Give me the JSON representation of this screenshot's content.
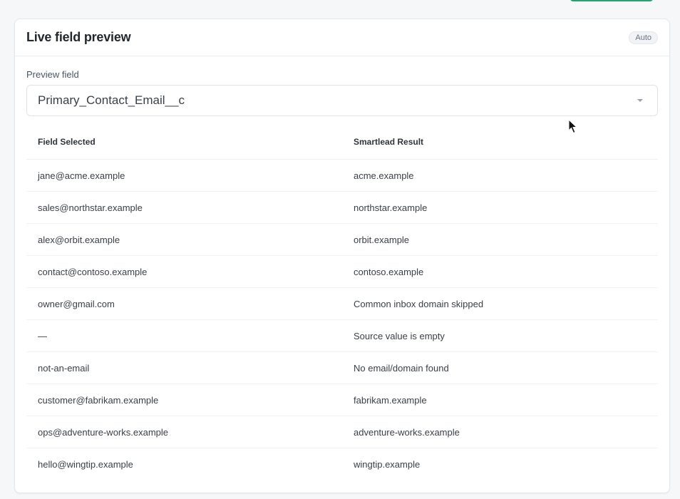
{
  "panel": {
    "title": "Live field preview",
    "badge": "Auto"
  },
  "preview_field": {
    "label": "Preview field",
    "value": "Primary_Contact_Email__c",
    "icon": "chevron-down-icon"
  },
  "table": {
    "columns": [
      "Field Selected",
      "Smartlead Result"
    ],
    "rows": [
      {
        "field": "jane@acme.example",
        "result": "acme.example",
        "muted": false
      },
      {
        "field": "sales@northstar.example",
        "result": "northstar.example",
        "muted": false
      },
      {
        "field": "alex@orbit.example",
        "result": "orbit.example",
        "muted": false
      },
      {
        "field": "contact@contoso.example",
        "result": "contoso.example",
        "muted": false
      },
      {
        "field": "owner@gmail.com",
        "result": "Common inbox domain skipped",
        "muted": true
      },
      {
        "field": "—",
        "result": "Source value is empty",
        "muted": true
      },
      {
        "field": "not-an-email",
        "result": "No email/domain found",
        "muted": true
      },
      {
        "field": "customer@fabrikam.example",
        "result": "fabrikam.example",
        "muted": false
      },
      {
        "field": "ops@adventure-works.example",
        "result": "adventure-works.example",
        "muted": false
      },
      {
        "field": "hello@wingtip.example",
        "result": "wingtip.example",
        "muted": false
      }
    ]
  },
  "colors": {
    "accent": "#2f9e6e",
    "muted_text": "#a5abb6"
  }
}
